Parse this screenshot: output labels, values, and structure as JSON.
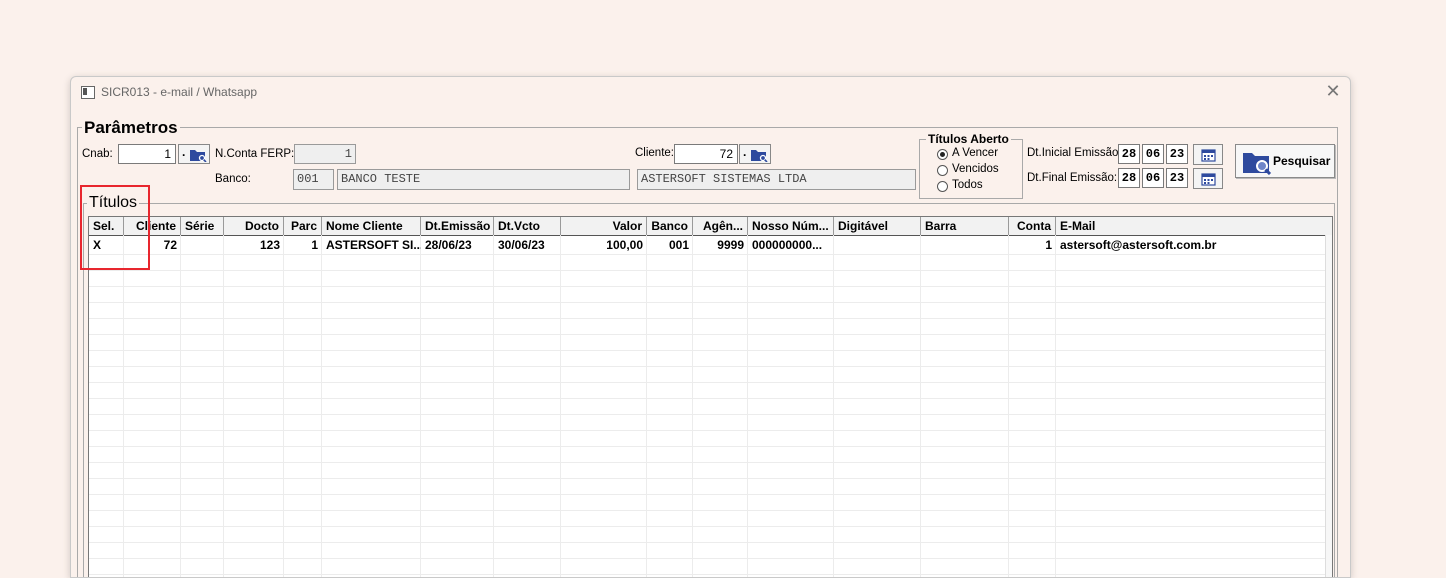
{
  "window": {
    "title": "SICR013 - e-mail / Whatsapp"
  },
  "parametros": {
    "legend": "Parâmetros",
    "cnab": {
      "label": "Cnab:",
      "value": "1"
    },
    "conta": {
      "label": "N.Conta FERP:",
      "value": "1"
    },
    "banco": {
      "label": "Banco:",
      "code": "001",
      "name": "BANCO TESTE"
    },
    "cliente": {
      "label": "Cliente:",
      "value": "72",
      "name": "ASTERSOFT SISTEMAS LTDA"
    },
    "lookup_dot": "."
  },
  "titulos_aberto": {
    "legend": "Títulos Aberto",
    "options": [
      "A Vencer",
      "Vencidos",
      "Todos"
    ],
    "selected": "A Vencer"
  },
  "dates": {
    "inicial": {
      "label": "Dt.Inicial Emissão:",
      "day": "28",
      "month": "06",
      "year": "23"
    },
    "final": {
      "label": "Dt.Final Emissão:",
      "day": "28",
      "month": "06",
      "year": "23"
    }
  },
  "search_button": {
    "label": "Pesquisar"
  },
  "titulos": {
    "legend": "Títulos",
    "columns": [
      "Sel.",
      "Cliente",
      "Série",
      "Docto",
      "Parc",
      "Nome Cliente",
      "Dt.Emissão",
      "Dt.Vcto",
      "Valor",
      "Banco",
      "Agên...",
      "Nosso Núm...",
      "Digitável",
      "Barra",
      "Conta",
      "E-Mail"
    ],
    "rows": [
      [
        "X",
        "72",
        "",
        "123",
        "1",
        "ASTERSOFT SI...",
        "28/06/23",
        "30/06/23",
        "100,00",
        "001",
        "9999",
        "000000000...",
        "",
        "",
        "1",
        "astersoft@astersoft.com.br"
      ]
    ]
  },
  "colors": {
    "background": "#fbf1ec",
    "highlight": "#e8262e",
    "icon_blue": "#2e4a9e"
  },
  "icons": [
    "app-icon",
    "close-icon",
    "folder-search-icon",
    "calendar-icon"
  ]
}
